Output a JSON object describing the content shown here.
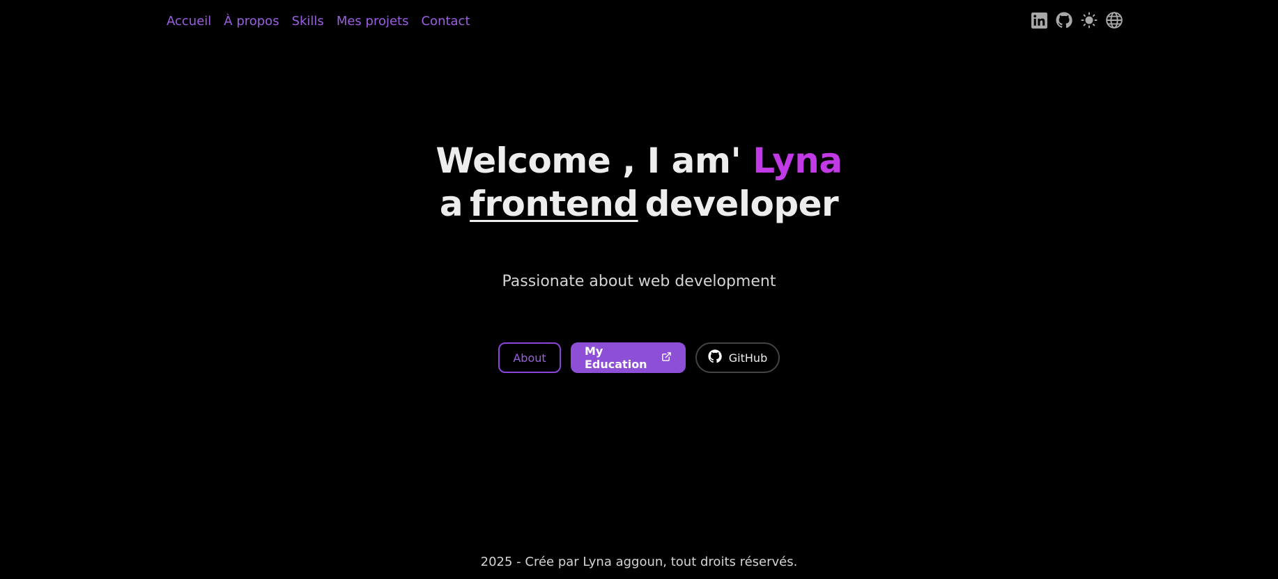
{
  "nav": {
    "links": [
      "Accueil",
      "À propos",
      "Skills",
      "Mes projets",
      "Contact"
    ],
    "icons": [
      "linkedin-icon",
      "github-icon",
      "sun-icon",
      "globe-icon"
    ]
  },
  "hero": {
    "line1_prefix": "Welcome , I am'",
    "name": "Lyna",
    "line2_prefix": "a",
    "role": "frontend",
    "line2_suffix": "developer",
    "subtitle": "Passionate about web development"
  },
  "buttons": {
    "about": "About",
    "education": "My Education",
    "github": "GitHub"
  },
  "footer": {
    "text": "2025 - Crée par Lyna aggoun, tout droits réservés."
  },
  "colors": {
    "background": "#000000",
    "accent": "#9b5fe0",
    "name_accent": "#c13ae6",
    "primary_button": "#8c4fd6"
  }
}
